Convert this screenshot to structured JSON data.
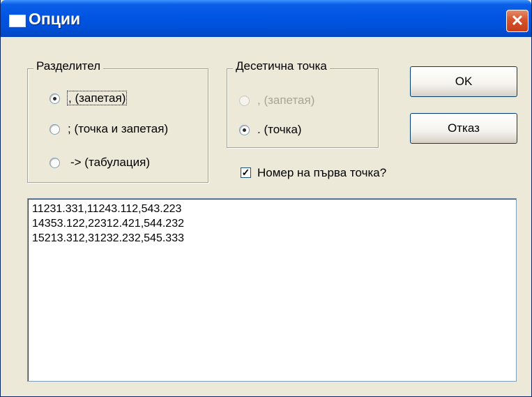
{
  "window": {
    "title": "Опции",
    "close_glyph": "✕"
  },
  "separator": {
    "legend": "Разделител",
    "options": [
      {
        "label": ", (запетая)",
        "checked": true
      },
      {
        "label": "; (точка и запетая)",
        "checked": false
      },
      {
        "label": "-> (табулация)",
        "checked": false
      }
    ]
  },
  "decimal": {
    "legend": "Десетична точка",
    "options": [
      {
        "label": ", (запетая)",
        "checked": false,
        "disabled": true
      },
      {
        "label": ". (точка)",
        "checked": true,
        "disabled": false
      }
    ]
  },
  "buttons": {
    "ok": "OK",
    "cancel": "Отказ"
  },
  "first_point_checkbox": {
    "label": "Номер на първа точка?",
    "checked": true,
    "check_glyph": "✓"
  },
  "output": {
    "lines": [
      "11231.331,11243.112,543.223",
      "14353.122,22312.421,544.232",
      "15213.312,31232.232,545.333"
    ]
  }
}
